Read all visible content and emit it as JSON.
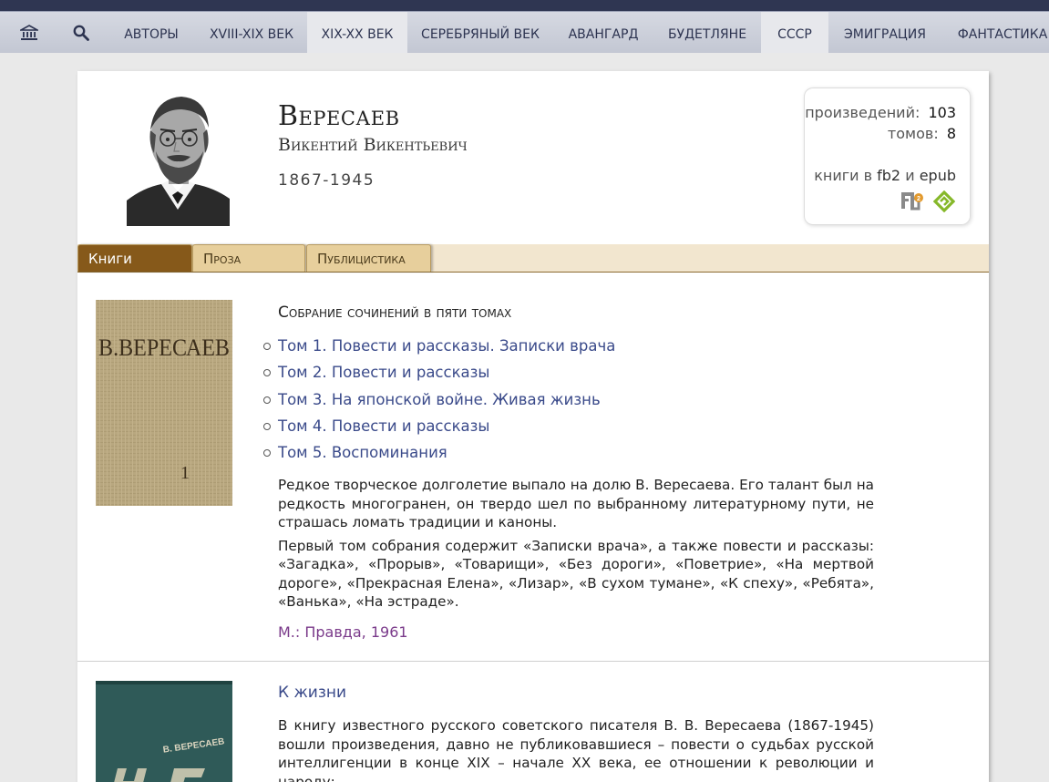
{
  "nav": {
    "items": [
      {
        "label": "АВТОРЫ",
        "active": false
      },
      {
        "label": "XVIII-XIX ВЕК",
        "active": false
      },
      {
        "label": "XIX-XX ВЕК",
        "active": true
      },
      {
        "label": "СЕРЕБРЯНЫЙ ВЕК",
        "active": false
      },
      {
        "label": "АВАНГАРД",
        "active": false
      },
      {
        "label": "БУДЕТЛЯНЕ",
        "active": false
      },
      {
        "label": "СССР",
        "active": true
      },
      {
        "label": "ЭМИГРАЦИЯ",
        "active": false
      },
      {
        "label": "ФАНТАСТИКА",
        "active": false
      }
    ]
  },
  "author": {
    "surname": "Вересаев",
    "name": "Викентий Викентьевич",
    "years": "1867-1945"
  },
  "stats": {
    "works_label": "произведений:",
    "works_count": "103",
    "volumes_label": "томов:",
    "volumes_count": "8",
    "books_prefix": "книги в",
    "format1": "fb2",
    "and": "и",
    "format2": "epub"
  },
  "tabs": [
    {
      "label": "Книги",
      "active": true
    },
    {
      "label": "Проза",
      "active": false
    },
    {
      "label": "Публицистика",
      "active": false
    }
  ],
  "books": [
    {
      "cover_text": "В.ВЕРЕСАЕВ",
      "cover_volume": "1",
      "title": "Собрание сочинений в пяти томах",
      "volumes": [
        "Том 1. Повести и рассказы. Записки врача",
        "Том 2. Повести и рассказы",
        "Том 3. На японской войне. Живая жизнь",
        "Том 4. Повести и рассказы",
        "Том 5. Воспоминания"
      ],
      "paragraphs": [
        "Редкое творческое долголетие выпало на долю В. Вересаева. Его талант был на редкость многогранен, он твердо шел по выбранному литературному пути, не страшась ломать традиции и каноны.",
        "Первый том собрания содержит «Записки врача», а также повести и рассказы: «Загадка», «Прорыв», «Товарищи», «Без дороги», «Поветрие», «На мертвой дороге», «Прекрасная Елена», «Лизар», «В сухом тумане», «К спеху», «Ребята», «Ванька», «На эстраде»."
      ],
      "publisher": "М.: Правда, 1961"
    },
    {
      "cover_text": "В. ВЕРЕСАЕВ",
      "title": "К жизни",
      "paragraphs": [
        "В книгу известного русского советского писателя В. В. Вересаева (1867-1945) вошли произведения, давно не публиковавшиеся – повести о судьбах русской интеллигенции в конце XIX – начале XX века, ее отношении к революции и народу:"
      ]
    }
  ]
}
